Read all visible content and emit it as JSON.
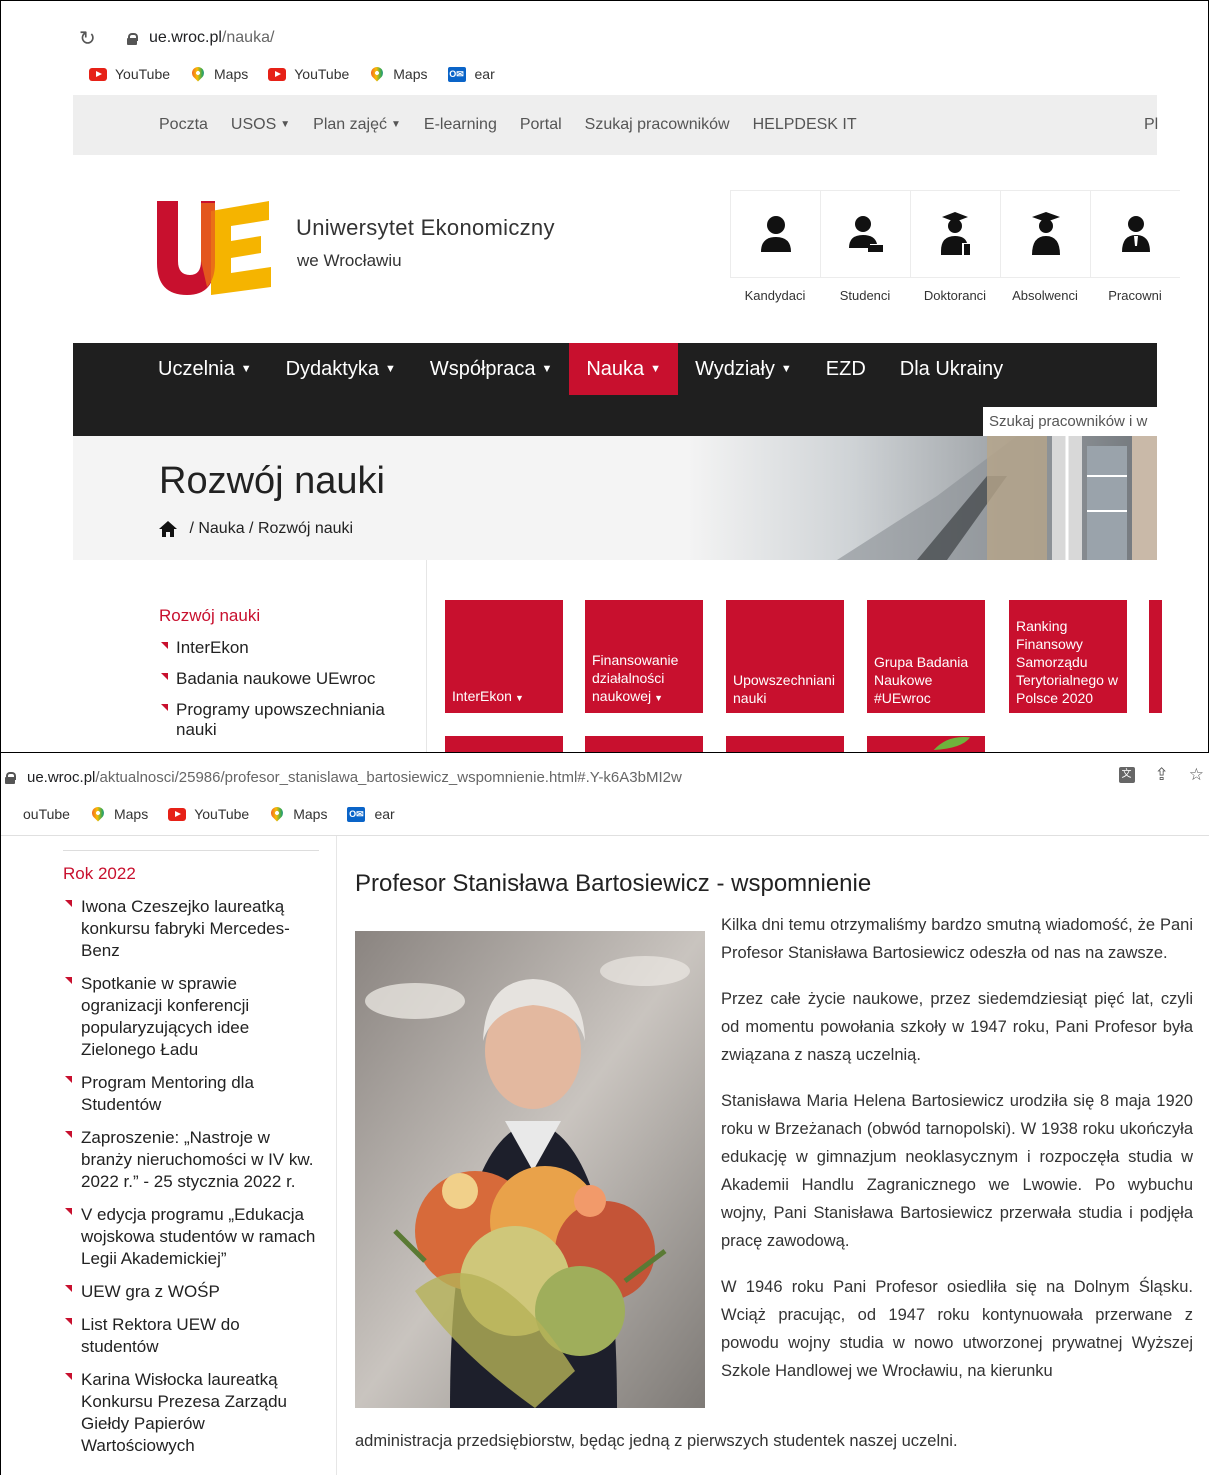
{
  "browser_top": {
    "url_host": "ue.wroc.pl",
    "url_path": "/nauka/",
    "bookmarks": [
      {
        "label": "YouTube",
        "icon": "youtube-icon"
      },
      {
        "label": "Maps",
        "icon": "maps-icon"
      },
      {
        "label": "YouTube",
        "icon": "youtube-icon"
      },
      {
        "label": "Maps",
        "icon": "maps-icon"
      },
      {
        "label": "ear",
        "icon": "outlook-icon"
      }
    ]
  },
  "topnav": {
    "items": [
      "Poczta",
      "USOS",
      "Plan zajęć",
      "E-learning",
      "Portal",
      "Szukaj pracowników",
      "HELPDESK IT"
    ],
    "cut_item": "Pl"
  },
  "brand": {
    "name": "Uniwersytet Ekonomiczny",
    "sub": "we Wrocławiu",
    "colors": {
      "red": "#c8102e",
      "yellow": "#f5b400",
      "nav_dark": "#1f1f1f"
    }
  },
  "groups": [
    "Kandydaci",
    "Studenci",
    "Doktoranci",
    "Absolwenci",
    "Pracowni"
  ],
  "mainnav": {
    "items": [
      "Uczelnia",
      "Dydaktyka",
      "Współpraca",
      "Nauka",
      "Wydziały",
      "EZD",
      "Dla Ukrainy"
    ],
    "active": "Nauka",
    "search_value": "Szukaj pracowników i w"
  },
  "hero": {
    "title": "Rozwój nauki",
    "crumbs": [
      "Nauka",
      "Rozwój nauki"
    ]
  },
  "sidebar_top": {
    "heading": "Rozwój nauki",
    "items": [
      "InterEkon",
      "Badania naukowe UEwroc",
      "Programy upowszechniania nauki"
    ]
  },
  "tiles": [
    "InterEkon",
    "Finansowanie działalności naukowej",
    "Upowszechniani nauki",
    "Grupa Badania Naukowe #UEwroc",
    "Ranking Finansowy Samorządu Terytorialnego w Polsce 2020"
  ],
  "browser_bottom": {
    "url_host": "ue.wroc.pl",
    "url_path": "/aktualnosci/25986/profesor_stanislawa_bartosiewicz_wspomnienie.html#.Y-k6A3bMI2w",
    "bookmarks": [
      {
        "label": "ouTube",
        "icon": "none"
      },
      {
        "label": "Maps",
        "icon": "maps-icon"
      },
      {
        "label": "YouTube",
        "icon": "youtube-icon"
      },
      {
        "label": "Maps",
        "icon": "maps-icon"
      },
      {
        "label": "ear",
        "icon": "outlook-icon"
      }
    ]
  },
  "sidebar_bottom": {
    "heading": "Rok 2022",
    "items": [
      "Iwona Czeszejko laureatką konkursu fabryki Mercedes-Benz",
      "Spotkanie w sprawie ogranizacji konferencji popularyzujących idee Zielonego Ładu",
      "Program Mentoring dla Studentów",
      "Zaproszenie: „Nastroje w branży nieruchomości w IV kw. 2022 r.” - 25 stycznia 2022 r.",
      "V edycja programu „Edukacja wojskowa studentów w ramach Legii Akademickiej”",
      "UEW gra z WOŚP",
      "List Rektora UEW do studentów",
      "Karina Wisłocka laureatką Konkursu Prezesa Zarządu Giełdy Papierów Wartościowych"
    ]
  },
  "article": {
    "title": "Profesor Stanisława Bartosiewicz - wspomnienie",
    "paragraphs": [
      "Kilka dni temu otrzymaliśmy bardzo smutną wiadomość, że Pani Profesor Stanisława Bartosiewicz odeszła od nas na zawsze.",
      "Przez całe życie naukowe, przez siedemdziesiąt pięć lat, czyli od momentu powołania szkoły w 1947 roku, Pani Profesor była związana z naszą uczelnią.",
      "Stanisława Maria Helena Bartosiewicz urodziła się 8 maja 1920 roku w Brzeżanach (obwód tarnopolski). W 1938 roku ukończyła edukację w gimnazjum neoklasycznym i rozpoczęła studia w Akademii Handlu Zagranicznego we Lwowie. Po wybuchu wojny, Pani Stanisława Bartosiewicz przerwała studia i podjęła pracę zawodową.",
      "W 1946 roku Pani Profesor osiedliła się na Dolnym Śląsku. Wciąż pracując, od 1947 roku kontynuowała przerwane z powodu wojny studia w nowo utworzonej prywatnej Wyższej Szkole Handlowej we Wrocławiu, na kierunku"
    ],
    "last_line": "administracja przedsiębiorstw, będąc jedną z pierwszych studentek naszej uczelni."
  }
}
